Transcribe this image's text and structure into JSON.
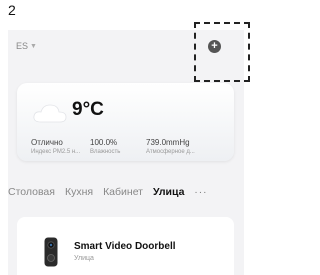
{
  "step_label": "2",
  "header": {
    "home_name": "ES",
    "add_icon": "plus-icon"
  },
  "weather": {
    "icon": "cloud-icon",
    "temperature": "9°C",
    "metrics": [
      {
        "value": "Отлично",
        "label": "Индекс PM2.5 н..."
      },
      {
        "value": "100.0%",
        "label": "Влажность"
      },
      {
        "value": "739.0mmHg",
        "label": "Атмосферное д..."
      }
    ]
  },
  "tabs": {
    "items": [
      "Столовая",
      "Кухня",
      "Кабинет",
      "Улица"
    ],
    "active_index": 3,
    "more_label": "···"
  },
  "device": {
    "icon": "video-doorbell-icon",
    "name": "Smart Video Doorbell",
    "room": "Улица"
  }
}
